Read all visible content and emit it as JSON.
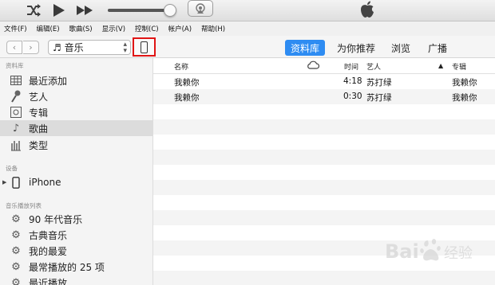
{
  "menubar": {
    "items": [
      "文件(F)",
      "编辑(E)",
      "歌曲(S)",
      "显示(V)",
      "控制(C)",
      "帐户(A)",
      "帮助(H)"
    ]
  },
  "toolbar": {
    "back_symbol": "‹",
    "forward_symbol": "›",
    "media_label": "♬ 音乐",
    "tabs": [
      "资料库",
      "为你推荐",
      "浏览",
      "广播"
    ],
    "active_tab": "资料库"
  },
  "sidebar": {
    "library_header": "资料库",
    "library_items": [
      {
        "label": "最近添加",
        "icon": "grid-icon"
      },
      {
        "label": "艺人",
        "icon": "microphone-icon"
      },
      {
        "label": "专辑",
        "icon": "album-icon"
      },
      {
        "label": "歌曲",
        "icon": "note-icon",
        "selected": true
      },
      {
        "label": "类型",
        "icon": "guitar-icon"
      }
    ],
    "devices_header": "设备",
    "device": {
      "label": "iPhone",
      "icon": "iphone-icon"
    },
    "playlists_header": "音乐播放列表",
    "playlists": [
      "90 年代音乐",
      "古典音乐",
      "我的最爱",
      "最常播放的 25 项",
      "最近播放"
    ]
  },
  "table": {
    "columns": {
      "name": "名称",
      "time": "时间",
      "artist": "艺人",
      "album": "专辑"
    },
    "rows": [
      {
        "name": "我赖你",
        "time": "4:18",
        "artist": "苏打绿",
        "album": "我赖你"
      },
      {
        "name": "我赖你",
        "time": "0:30",
        "artist": "苏打绿",
        "album": "我赖你"
      }
    ]
  },
  "colors": {
    "accent": "#2e8cf2",
    "highlight_box": "#e01515"
  }
}
